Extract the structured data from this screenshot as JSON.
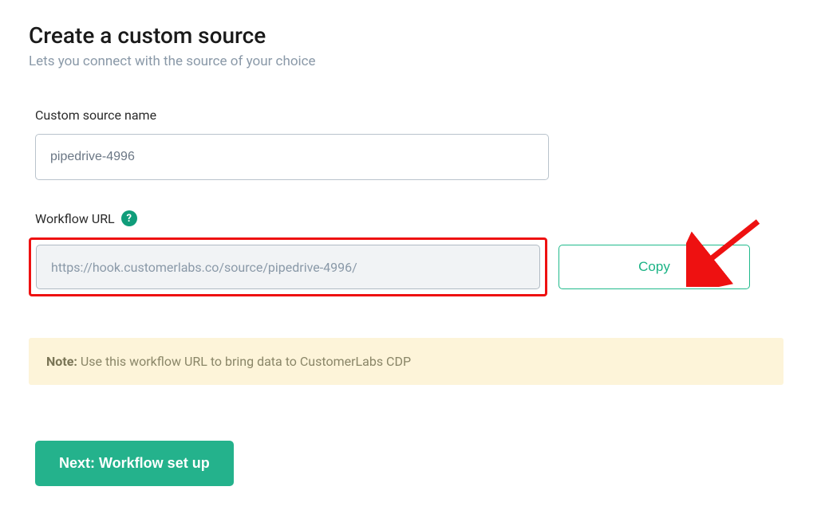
{
  "header": {
    "title": "Create a custom source",
    "subtitle": "Lets you connect with the source of your choice"
  },
  "source_name": {
    "label": "Custom source name",
    "value": "pipedrive-4996"
  },
  "workflow_url": {
    "label": "Workflow URL",
    "help_glyph": "?",
    "value": "https://hook.customerlabs.co/source/pipedrive-4996/",
    "copy_label": "Copy"
  },
  "note": {
    "prefix": "Note:",
    "text": " Use this workflow URL to bring data to CustomerLabs CDP"
  },
  "next_button_label": "Next: Workflow set up"
}
